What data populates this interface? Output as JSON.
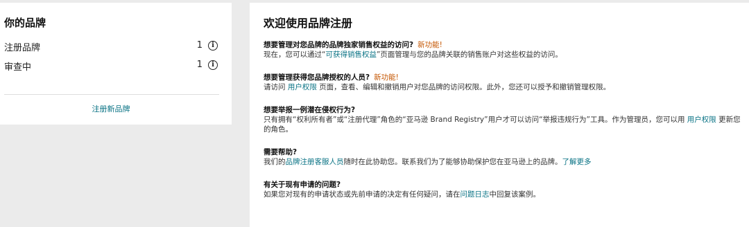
{
  "left": {
    "title": "你的品牌",
    "rows": [
      {
        "label": "注册品牌",
        "count": "1",
        "icon": "info-icon"
      },
      {
        "label": "审查中",
        "count": "1",
        "icon": "info-icon"
      }
    ],
    "register_link": "注册新品牌"
  },
  "right": {
    "title": "欢迎使用品牌注册",
    "s1": {
      "question": "想要管理对您品牌的品牌独家销售权益的访问?",
      "new": "新功能!",
      "pre": "现在，您可以通过“",
      "link": "可获得销售权益",
      "post": "”页面管理与您的品牌关联的销售账户对这些权益的访问。"
    },
    "s2": {
      "question": "想要管理获得您品牌授权的人员?",
      "new": "新功能!",
      "pre": "请访问 ",
      "link": "用户权限",
      "post": " 页面，查看、编辑和撤销用户对您品牌的访问权限。此外，您还可以授予和撤销管理权限。"
    },
    "s3": {
      "question": "想要举报一例潜在侵权行为?",
      "pre": "只有拥有“权利所有者”或“注册代理”角色的“亚马逊 Brand Registry”用户才可以访问“举报违规行为”工具。作为管理员，您可以用 ",
      "link": "用户权限",
      "post": " 更新您的角色。"
    },
    "s4": {
      "question": "需要帮助?",
      "pre": "我们的",
      "link": "品牌注册客服人员",
      "mid": "随时在此协助您。联系我们为了能够协助保护您在亚马逊上的品牌。",
      "link2": "了解更多"
    },
    "s5": {
      "question": "有关于现有申请的问题?",
      "pre": "如果您对现有的申请状态或先前申请的决定有任何疑问，请在",
      "link": "问题日志",
      "post": "中回复该案例。"
    }
  }
}
